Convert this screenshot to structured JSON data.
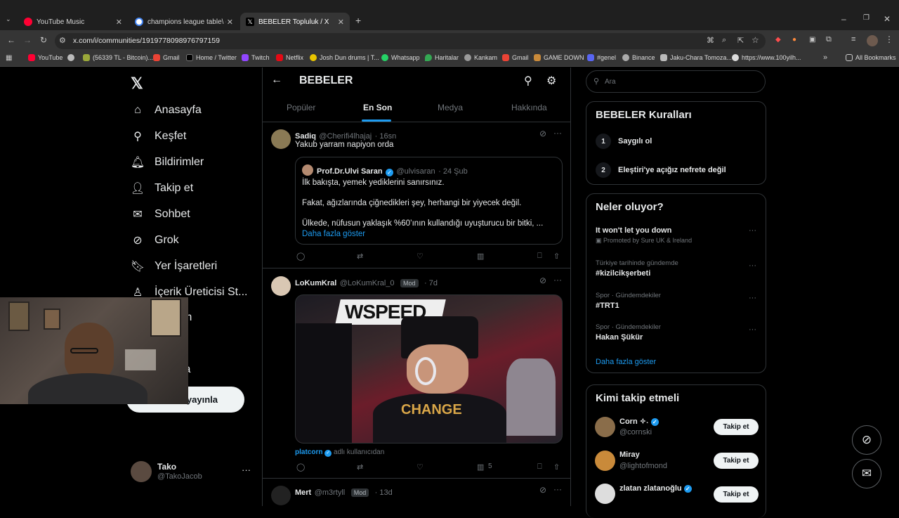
{
  "browser": {
    "tabs": [
      {
        "title": "YouTube Music",
        "color": "#ff0033"
      },
      {
        "title": "champions league table\\ - Goo",
        "color": "#4285f4"
      },
      {
        "title": "BEBELER Topluluk / X",
        "color": "#ffffff"
      }
    ],
    "url": "x.com/i/communities/1919778098976797159",
    "bookmarks": [
      "YouTube",
      "(56339 TL - Bitcoin)...",
      "Gmail",
      "Home / Twitter",
      "Twitch",
      "Netflix",
      "Josh Dun drums | T...",
      "Whatsapp",
      "Haritalar",
      "Kankam",
      "Gmail",
      "GAME DOWN",
      "#genel",
      "Binance",
      "Jaku-Chara Tomoza...",
      "https://www.100yilh..."
    ],
    "all_bookmarks": "All Bookmarks"
  },
  "nav": {
    "items": [
      "Anasayfa",
      "Keşfet",
      "Bildirimler",
      "Takip et",
      "Sohbet",
      "Grok",
      "Yer İşaretleri",
      "İçerik Üreticisi St...",
      "m",
      "azla"
    ],
    "post_label": "yayınla",
    "profile": {
      "name": "Tako",
      "handle": "@TakoJacob"
    }
  },
  "community": {
    "title": "BEBELER",
    "tabs": [
      "Popüler",
      "En Son",
      "Medya",
      "Hakkında"
    ],
    "active_tab": "En Son"
  },
  "tweets": [
    {
      "name": "Sadiq",
      "handle": "@Cherifi4lhajaj",
      "time": "· 16sn",
      "text": "Yakub yarram napiyon orda",
      "quote": {
        "name": "Prof.Dr.Ulvi Saran",
        "handle": "@ulvisaran",
        "time": "· 24 Şub",
        "line1": "İlk bakışta, yemek yediklerini sanırsınız.",
        "line2": "Fakat, ağızlarında çiğnedikleri şey, herhangi bir yiyecek değil.",
        "line3": "Ülkede, nüfusun yaklaşık %60’ının kullandığı uyuşturucu bir bitki, ...",
        "more": "Daha fazla göster"
      }
    },
    {
      "name": "LoKumKral",
      "handle": "@LoKumKral_0",
      "badge": "Mod",
      "time": "· 7d",
      "media_text": "WSPEED",
      "shirt_text": "CHANGE",
      "via_name": "platcorn",
      "via_suffix": "adlı kullanıcıdan",
      "views": "5"
    },
    {
      "name": "Mert",
      "handle": "@m3rtyll",
      "badge": "Mod",
      "time": "· 13d"
    }
  ],
  "right": {
    "search_placeholder": "Ara",
    "rules_title": "BEBELER Kuralları",
    "rules": [
      {
        "num": "1",
        "text": "Saygılı ol"
      },
      {
        "num": "2",
        "text": "Eleştiri'ye açığız nefrete değil"
      }
    ],
    "trends_title": "Neler oluyor?",
    "trends": [
      {
        "meta": "",
        "title": "It won't let you down",
        "promo": "Promoted by Sure UK & Ireland"
      },
      {
        "meta": "Türkiye tarihinde gündemde",
        "title": "#kizilcikşerbeti"
      },
      {
        "meta": "Spor · Gündemdekiler",
        "title": "#TRT1"
      },
      {
        "meta": "Spor · Gündemdekiler",
        "title": "Hakan Şükür"
      }
    ],
    "trends_more": "Daha fazla göster",
    "follow_title": "Kimi takip etmeli",
    "follow": [
      {
        "name": "Corn ✧˖",
        "handle": "@cornski",
        "button": "Takip et"
      },
      {
        "name": "Miray",
        "handle": "@lightofmond",
        "button": "Takip et"
      },
      {
        "name": "zlatan zlatanoğlu",
        "handle": "",
        "button": "Takip et"
      }
    ]
  },
  "colors": {
    "accent": "#1d9bf0",
    "background": "#000000",
    "border": "#2f3336"
  }
}
